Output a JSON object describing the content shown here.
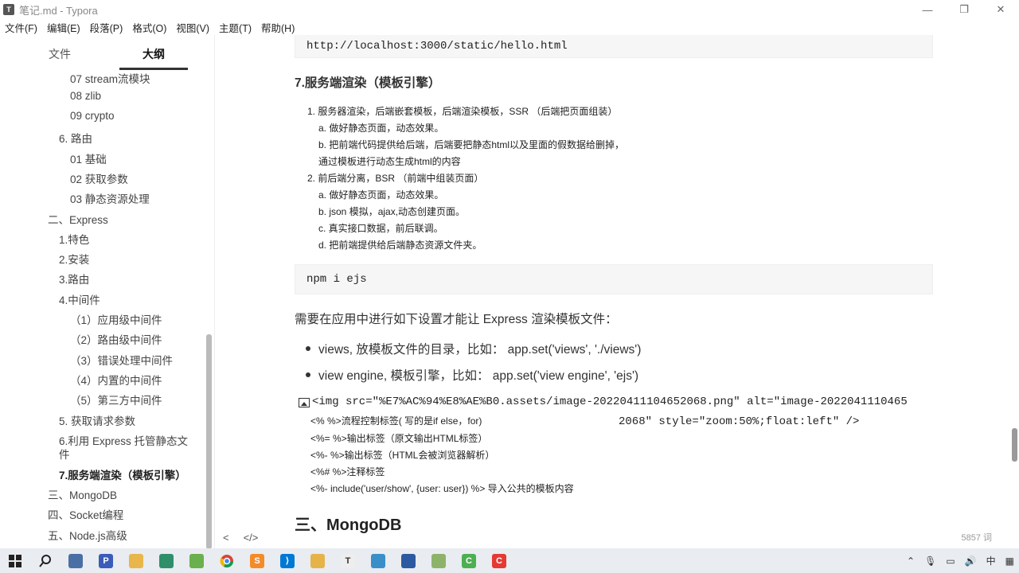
{
  "window": {
    "title": "笔记.md - Typora",
    "app_icon": "T",
    "minimize": "—",
    "restore": "❐",
    "close": "✕"
  },
  "menu": [
    "文件(F)",
    "编辑(E)",
    "段落(P)",
    "格式(O)",
    "视图(V)",
    "主题(T)",
    "帮助(H)"
  ],
  "sidebar": {
    "tabs": [
      "文件",
      "大纲"
    ],
    "active_tab": "大纲",
    "outline": [
      {
        "label": "07 stream流模块"
      },
      {
        "label": "08 zlib"
      },
      {
        "label": "09 crypto"
      },
      {
        "label": "6. 路由"
      },
      {
        "label": "01 基础"
      },
      {
        "label": "02 获取参数"
      },
      {
        "label": "03 静态资源处理"
      },
      {
        "label": "二、Express"
      },
      {
        "label": "1.特色"
      },
      {
        "label": "2.安装"
      },
      {
        "label": "3.路由"
      },
      {
        "label": "4.中间件"
      },
      {
        "label": "（1）应用级中间件"
      },
      {
        "label": "（2）路由级中间件"
      },
      {
        "label": "（3）错误处理中间件"
      },
      {
        "label": "（4）内置的中间件"
      },
      {
        "label": "（5）第三方中间件"
      },
      {
        "label": "5. 获取请求参数"
      },
      {
        "label": "6.利用 Express 托管静态文"
      },
      {
        "label": "件"
      },
      {
        "label": "7.服务端渲染（模板引擎）"
      },
      {
        "label": "三、MongoDB"
      },
      {
        "label": "四、Socket编程"
      },
      {
        "label": "五、Node.js高级"
      }
    ]
  },
  "editor": {
    "code1": "http://localhost:3000/static/hello.html",
    "heading": "7.服务端渲染（模板引擎）",
    "list": [
      "1. 服务器渲染，后端嵌套模板，后端渲染模板，SSR （后端把页面组装）",
      "a. 做好静态页面，动态效果。",
      "b. 把前端代码提供给后端，后端要把静态html以及里面的假数据给删掉，",
      "通过模板进行动态生成html的内容",
      "2. 前后端分离，BSR （前端中组装页面）",
      "a. 做好静态页面，动态效果。",
      "b. json 模拟，ajax,动态创建页面。",
      "c. 真实接口数据，前后联调。",
      "d. 把前端提供给后端静态资源文件夹。"
    ],
    "code2": "npm i ejs",
    "para": "需要在应用中进行如下设置才能让 Express 渲染模板文件：",
    "bullets": [
      "views, 放模板文件的目录，比如： app.set('views', './views')",
      "view engine, 模板引擎，比如： app.set('view engine', 'ejs')"
    ],
    "img_line1": "<img src=\"%E7%AC%94%E8%AE%B0.assets/image-20220411104652068.png\" alt=\"image-2022041110465",
    "img_line2": "2068\" style=\"zoom:50%;float:left\" />",
    "tags": [
      "<% %>流程控制标签( 写的是if else，for)",
      "<%= %>输出标签（原文输出HTML标签）",
      "<%- %>输出标签（HTML会被浏览器解析）",
      "<%# %>注释标签",
      "<%- include('user/show', {user: user}) %> 导入公共的模板内容"
    ],
    "heading2": "三、MongoDB"
  },
  "footer": {
    "back": "<",
    "source": "</>",
    "wordcount": "5857 词"
  },
  "taskbar": {
    "tray_ime": "中"
  }
}
